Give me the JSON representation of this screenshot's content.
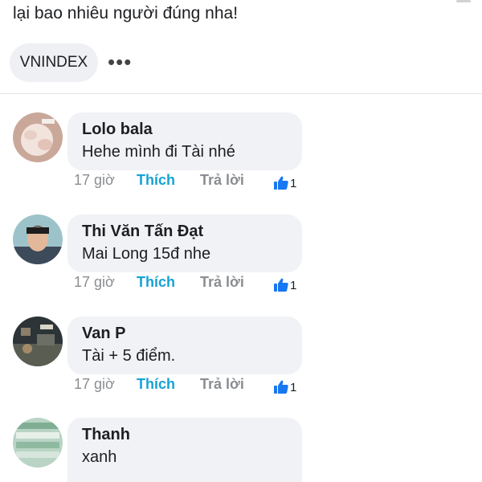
{
  "post": {
    "text": "lại bao nhiêu người đúng nha!",
    "tag": "VNINDEX",
    "more_icon": "more-horizontal-icon"
  },
  "colors": {
    "link_blue": "#16a2d6",
    "like_blue": "#1877f2",
    "bubble_bg": "#f0f2f5",
    "meta_gray": "#8a8d91"
  },
  "comments": [
    {
      "name": "Lolo bala",
      "text": "Hehe mình đi Tài nhé",
      "time": "17 giờ",
      "like_label": "Thích",
      "reply_label": "Trả lời",
      "likes": "1",
      "avatar_icon": "user-avatar"
    },
    {
      "name": "Thi Văn Tấn Đạt",
      "text": "Mai Long 15đ nhe",
      "time": "17 giờ",
      "like_label": "Thích",
      "reply_label": "Trả lời",
      "likes": "1",
      "avatar_icon": "user-avatar"
    },
    {
      "name": "Van P",
      "text": "Tài + 5 điểm.",
      "time": "17 giờ",
      "like_label": "Thích",
      "reply_label": "Trả lời",
      "likes": "1",
      "avatar_icon": "user-avatar"
    },
    {
      "name": "Thanh",
      "text": "xanh",
      "avatar_icon": "user-avatar"
    }
  ]
}
